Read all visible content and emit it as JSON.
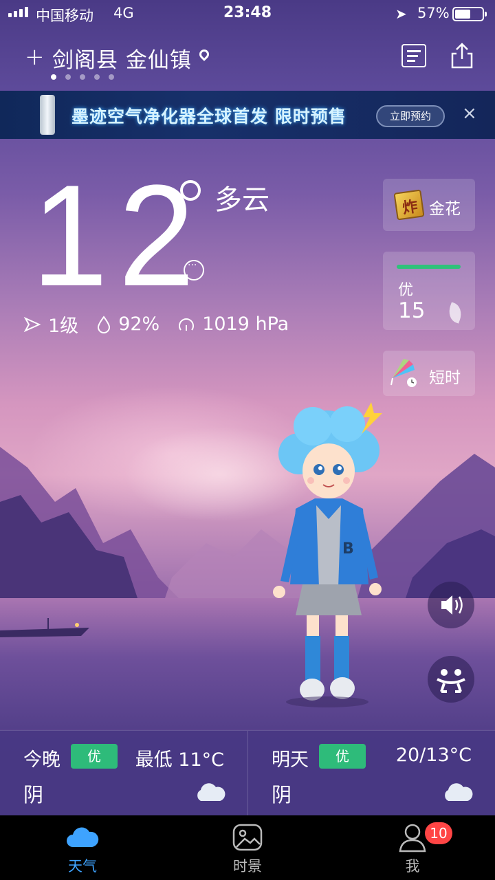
{
  "status_bar": {
    "carrier": "中国移动",
    "network": "4G",
    "time": "23:48",
    "battery": "57%"
  },
  "header": {
    "add_label": "+",
    "city": "剑阁县 金仙镇",
    "page_dots": 5,
    "active_page": 1
  },
  "ad": {
    "text": "墨迹空气净化器全球首发 限时预售",
    "cta": "立即预约",
    "close": "×"
  },
  "current": {
    "temperature": "12",
    "condition": "多云",
    "wind": "1级",
    "humidity": "92%",
    "pressure": "1019 hPa"
  },
  "side_cards": {
    "luck_label": "金花",
    "aqi_level": "优",
    "aqi_value": "15",
    "short_label": "短时"
  },
  "forecast": {
    "tonight": {
      "day": "今晚",
      "aqi": "优",
      "temp": "最低 11°C",
      "weather": "阴"
    },
    "tomorrow": {
      "day": "明天",
      "aqi": "优",
      "temp": "20/13°C",
      "weather": "阴"
    }
  },
  "tabs": [
    {
      "label": "天气",
      "icon": "cloud-icon",
      "active": true
    },
    {
      "label": "时景",
      "icon": "photo-icon",
      "active": false
    },
    {
      "label": "我",
      "icon": "user-icon",
      "active": false
    }
  ],
  "notifications": "10",
  "colors": {
    "accent": "#3ea3ff",
    "aqi_good": "#2ebb7a",
    "badge_red": "#ff4545"
  }
}
